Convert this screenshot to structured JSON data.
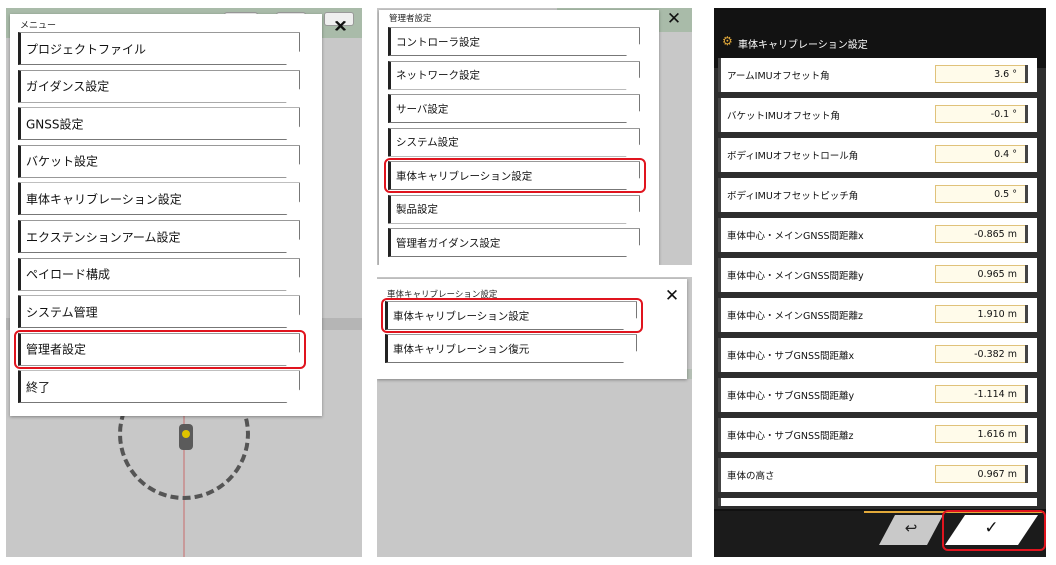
{
  "panel1": {
    "title": "メニュー",
    "close_glyph": "✕",
    "items": [
      {
        "label": "プロジェクトファイル"
      },
      {
        "label": "ガイダンス設定"
      },
      {
        "label": "GNSS設定"
      },
      {
        "label": "バケット設定"
      },
      {
        "label": "車体キャリブレーション設定"
      },
      {
        "label": "エクステンションアーム設定"
      },
      {
        "label": "ペイロード構成"
      },
      {
        "label": "システム管理"
      },
      {
        "label": "管理者設定",
        "highlighted": true
      },
      {
        "label": "終了"
      }
    ]
  },
  "panel2": {
    "title": "管理者設定",
    "close_glyph": "✕",
    "items": [
      {
        "label": "コントローラ設定"
      },
      {
        "label": "ネットワーク設定"
      },
      {
        "label": "サーバ設定"
      },
      {
        "label": "システム設定"
      },
      {
        "label": "車体キャリブレーション設定",
        "highlighted": true
      },
      {
        "label": "製品設定"
      },
      {
        "label": "管理者ガイダンス設定"
      }
    ]
  },
  "panel3": {
    "title": "車体キャリブレーション設定",
    "close_glyph": "✕",
    "items": [
      {
        "label": "車体キャリブレーション設定",
        "highlighted": true
      },
      {
        "label": "車体キャリブレーション復元"
      }
    ]
  },
  "panel4": {
    "title": "車体キャリブレーション設定",
    "title_icon": "gear-icon",
    "rows": [
      {
        "label": "アームIMUオフセット角",
        "value": "3.6 °"
      },
      {
        "label": "バケットIMUオフセット角",
        "value": "-0.1 °"
      },
      {
        "label": "ボディIMUオフセットロール角",
        "value": "0.4 °"
      },
      {
        "label": "ボディIMUオフセットピッチ角",
        "value": "0.5 °"
      },
      {
        "label": "車体中心・メインGNSS間距離x",
        "value": "-0.865 m"
      },
      {
        "label": "車体中心・メインGNSS間距離y",
        "value": "0.965 m"
      },
      {
        "label": "車体中心・メインGNSS間距離z",
        "value": "1.910 m"
      },
      {
        "label": "車体中心・サブGNSS間距離x",
        "value": "-0.382 m"
      },
      {
        "label": "車体中心・サブGNSS間距離y",
        "value": "-1.114 m"
      },
      {
        "label": "車体中心・サブGNSS間距離z",
        "value": "1.616 m"
      },
      {
        "label": "車体の高さ",
        "value": "0.967 m"
      }
    ],
    "back_glyph": "↩",
    "ok_glyph": "✓"
  },
  "colors": {
    "highlight": "#e0141e",
    "accent": "#e2a93a",
    "dark_bg": "#2d2d2d"
  }
}
